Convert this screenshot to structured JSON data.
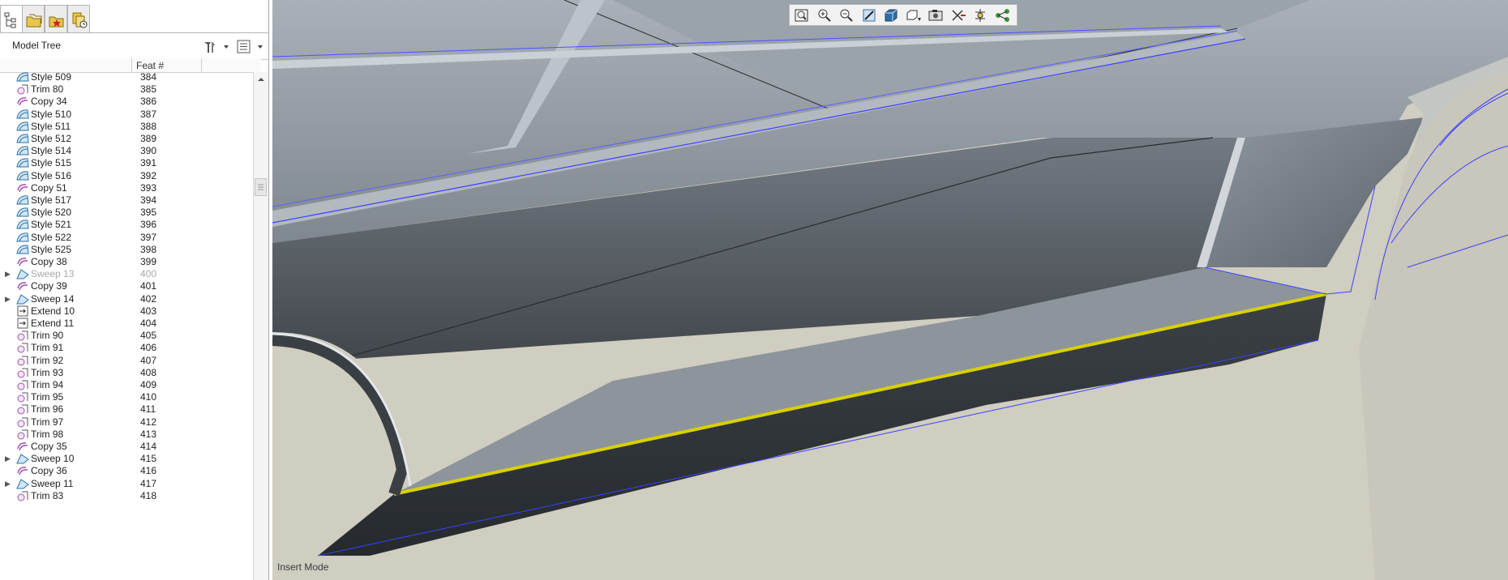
{
  "model_tree": {
    "title": "Model Tree",
    "column_feat": "Feat #",
    "rows": [
      {
        "name": "Style 509",
        "feat": "384",
        "icon": "style-icon"
      },
      {
        "name": "Trim 80",
        "feat": "385",
        "icon": "trim-icon"
      },
      {
        "name": "Copy 34",
        "feat": "386",
        "icon": "copy-icon"
      },
      {
        "name": "Style 510",
        "feat": "387",
        "icon": "style-icon"
      },
      {
        "name": "Style 511",
        "feat": "388",
        "icon": "style-icon"
      },
      {
        "name": "Style 512",
        "feat": "389",
        "icon": "style-icon"
      },
      {
        "name": "Style 514",
        "feat": "390",
        "icon": "style-icon"
      },
      {
        "name": "Style 515",
        "feat": "391",
        "icon": "style-icon"
      },
      {
        "name": "Style 516",
        "feat": "392",
        "icon": "style-icon"
      },
      {
        "name": "Copy 51",
        "feat": "393",
        "icon": "copy-icon"
      },
      {
        "name": "Style 517",
        "feat": "394",
        "icon": "style-icon"
      },
      {
        "name": "Style 520",
        "feat": "395",
        "icon": "style-icon"
      },
      {
        "name": "Style 521",
        "feat": "396",
        "icon": "style-icon"
      },
      {
        "name": "Style 522",
        "feat": "397",
        "icon": "style-icon"
      },
      {
        "name": "Style 525",
        "feat": "398",
        "icon": "style-icon"
      },
      {
        "name": "Copy 38",
        "feat": "399",
        "icon": "copy-icon"
      },
      {
        "name": "Sweep 13",
        "feat": "400",
        "icon": "sweep-icon",
        "expandable": true,
        "dim": true
      },
      {
        "name": "Copy 39",
        "feat": "401",
        "icon": "copy-icon"
      },
      {
        "name": "Sweep 14",
        "feat": "402",
        "icon": "sweep-icon",
        "expandable": true
      },
      {
        "name": "Extend 10",
        "feat": "403",
        "icon": "extend-icon"
      },
      {
        "name": "Extend 11",
        "feat": "404",
        "icon": "extend-icon"
      },
      {
        "name": "Trim 90",
        "feat": "405",
        "icon": "trim-icon"
      },
      {
        "name": "Trim 91",
        "feat": "406",
        "icon": "trim-icon"
      },
      {
        "name": "Trim 92",
        "feat": "407",
        "icon": "trim-icon"
      },
      {
        "name": "Trim 93",
        "feat": "408",
        "icon": "trim-icon"
      },
      {
        "name": "Trim 94",
        "feat": "409",
        "icon": "trim-icon"
      },
      {
        "name": "Trim 95",
        "feat": "410",
        "icon": "trim-icon"
      },
      {
        "name": "Trim 96",
        "feat": "411",
        "icon": "trim-icon"
      },
      {
        "name": "Trim 97",
        "feat": "412",
        "icon": "trim-icon"
      },
      {
        "name": "Trim 98",
        "feat": "413",
        "icon": "trim-icon"
      },
      {
        "name": "Copy 35",
        "feat": "414",
        "icon": "copy-icon"
      },
      {
        "name": "Sweep 10",
        "feat": "415",
        "icon": "sweep-icon",
        "expandable": true
      },
      {
        "name": "Copy 36",
        "feat": "416",
        "icon": "copy-icon"
      },
      {
        "name": "Sweep 11",
        "feat": "417",
        "icon": "sweep-icon",
        "expandable": true
      },
      {
        "name": "Trim 83",
        "feat": "418",
        "icon": "trim-icon"
      }
    ]
  },
  "viewport": {
    "status": "Insert Mode",
    "toolbar": [
      "refit-icon",
      "zoom-in-icon",
      "zoom-out-icon",
      "repaint-icon",
      "display-style-icon",
      "saved-orientations-icon",
      "view-manager-icon",
      "datum-display-icon",
      "spin-center-icon",
      "annotation-display-icon"
    ],
    "selection_color": "#d8d000"
  }
}
